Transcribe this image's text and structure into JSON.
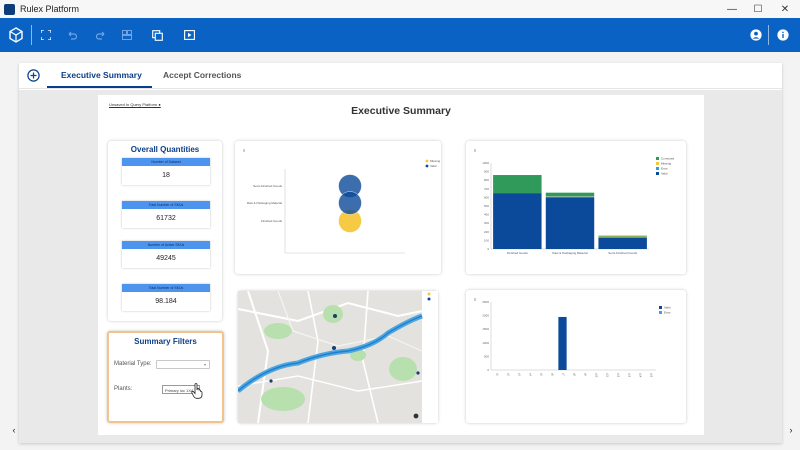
{
  "window": {
    "title": "Rulex Platform"
  },
  "tabs": [
    {
      "label": "Executive Summary"
    },
    {
      "label": "Accept Corrections"
    }
  ],
  "report": {
    "link_text": "Unsaved In Query Platform ●",
    "title": "Executive Summary"
  },
  "overall_quantities": {
    "title": "Overall Quantities",
    "kpis": [
      {
        "label": "Number of Dataset",
        "value": "18"
      },
      {
        "label": "Total Number of SKUs",
        "value": "61732"
      },
      {
        "label": "Number of Active SKUs",
        "value": "49245"
      },
      {
        "label": "Total Number of SKUs",
        "value": "98.184"
      }
    ]
  },
  "filters": {
    "title": "Summary Filters",
    "material_type_label": "Material Type:",
    "material_type_value": "",
    "plants_label": "Plants:",
    "plants_value": "Primary loc 1X4"
  },
  "colors": {
    "toolbar": "#0b62c5",
    "accent": "#0a3f8a",
    "kpi_header": "#4d94ee",
    "series_dark": "#0b4a9a",
    "series_green": "#2f9a5a",
    "series_yellow": "#f5c73b"
  },
  "chart_data": [
    {
      "type": "scatter",
      "subtype": "bubble",
      "y_categories": [
        "Semi-Finished Goods",
        "Raw & Packaging Material",
        "Finished Goods"
      ],
      "series": [
        {
          "name": "Missing",
          "color": "#f5c73b",
          "points": [
            {
              "y": "Finished Goods",
              "size": 0.55
            }
          ]
        },
        {
          "name": "Valid",
          "color": "#0b4a9a",
          "points": [
            {
              "y": "Semi-Finished Goods",
              "size": 0.55
            },
            {
              "y": "Raw & Packaging Material",
              "size": 0.55
            }
          ]
        }
      ]
    },
    {
      "type": "bar",
      "stacked": true,
      "categories": [
        "Finished Goods",
        "Raw & Packaging Material",
        "Semi-Finished Goods"
      ],
      "series": [
        {
          "name": "Valid",
          "color": "#0b4a9a",
          "values": [
            650,
            600,
            130
          ]
        },
        {
          "name": "Error",
          "color": "#2ea0d6",
          "values": [
            0,
            10,
            10
          ]
        },
        {
          "name": "Missing",
          "color": "#f5c73b",
          "values": [
            0,
            5,
            5
          ]
        },
        {
          "name": "Corrected",
          "color": "#2f9a5a",
          "values": [
            210,
            40,
            10
          ]
        }
      ],
      "ylim": [
        0,
        1000
      ],
      "yticks": [
        0,
        100,
        200,
        300,
        400,
        500,
        600,
        700,
        800,
        900,
        1000
      ],
      "legend": "top-right"
    },
    {
      "type": "bar",
      "categories": [
        "c1",
        "c2",
        "c3",
        "c4",
        "c5",
        "c6",
        "c7",
        "c8",
        "c9",
        "c10",
        "c11",
        "c12",
        "c13",
        "c14",
        "c15"
      ],
      "series": [
        {
          "name": "Valid",
          "color": "#0b4a9a",
          "values": [
            0,
            0,
            0,
            0,
            0,
            0,
            1950,
            0,
            0,
            0,
            0,
            0,
            0,
            0,
            0
          ]
        },
        {
          "name": "Error",
          "color": "#4d94ee",
          "values": [
            0,
            0,
            0,
            0,
            0,
            0,
            0,
            0,
            0,
            0,
            0,
            0,
            0,
            0,
            0
          ]
        }
      ],
      "ylim": [
        0,
        2500
      ],
      "yticks": [
        0,
        500,
        1000,
        1500,
        2000,
        2500
      ],
      "legend": "top-right"
    }
  ]
}
